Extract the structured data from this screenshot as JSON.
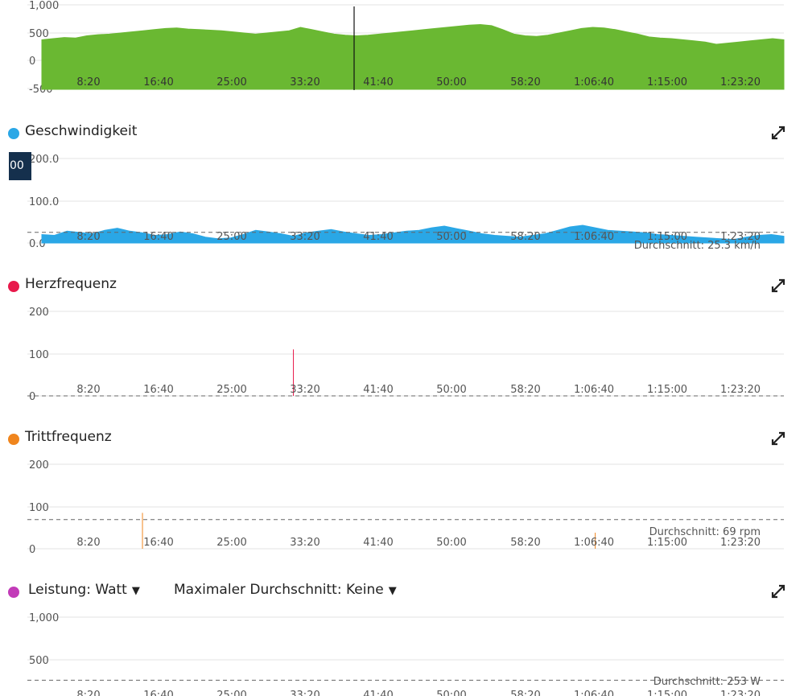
{
  "x_ticks": [
    "8:20",
    "16:40",
    "25:00",
    "33:20",
    "41:40",
    "50:00",
    "58:20",
    "1:06:40",
    "1:15:00",
    "1:23:20"
  ],
  "hover_label": "00",
  "charts": [
    {
      "id": "elevation",
      "title": "",
      "color": "#6ab832",
      "y_ticks": [
        "1,000",
        "500",
        "0",
        "-500"
      ],
      "avg_label": ""
    },
    {
      "id": "speed",
      "title": "Geschwindigkeit",
      "color": "#2aa7e6",
      "y_ticks": [
        "200.0",
        "100.0",
        "0.0"
      ],
      "avg_label": "Durchschnitt: 25.3 km/h"
    },
    {
      "id": "heartrate",
      "title": "Herzfrequenz",
      "color": "#e8194b",
      "y_ticks": [
        "200",
        "100",
        "0"
      ],
      "avg_label": ""
    },
    {
      "id": "cadence",
      "title": "Trittfrequenz",
      "color": "#f0851d",
      "y_ticks": [
        "200",
        "100",
        "0"
      ],
      "avg_label": "Durchschnitt: 69 rpm"
    },
    {
      "id": "power",
      "title": "",
      "color": "#c23bb8",
      "y_ticks": [
        "1,000",
        "500"
      ],
      "avg_label": "Durchschnitt: 253 W"
    }
  ],
  "power_header": {
    "metric_select": "Leistung: Watt",
    "max_avg_select": "Maximaler Durchschnitt: Keine"
  },
  "chart_data": [
    {
      "type": "area",
      "series": [
        {
          "values": [
            380,
            400,
            420,
            410,
            450,
            470,
            480,
            500,
            520,
            540,
            560,
            580,
            590,
            570,
            560,
            550,
            540,
            520,
            500,
            480,
            500,
            520,
            540,
            600,
            560,
            520,
            480,
            460,
            450,
            460,
            480,
            500,
            520,
            540,
            560,
            580,
            600,
            620,
            640,
            650,
            630,
            560,
            480,
            450,
            440,
            460,
            500,
            540,
            580,
            600,
            590,
            560,
            520,
            480,
            430,
            410,
            400,
            380,
            360,
            340,
            300,
            320,
            340,
            360,
            380,
            400,
            380
          ]
        }
      ],
      "x_range": [
        0,
        5520
      ],
      "ylim": [
        -500,
        1000
      ]
    },
    {
      "type": "area",
      "series": [
        {
          "values": [
            20,
            18,
            28,
            25,
            22,
            30,
            35,
            28,
            24,
            18,
            20,
            26,
            22,
            14,
            10,
            12,
            20,
            30,
            26,
            22,
            16,
            24,
            28,
            32,
            26,
            22,
            18,
            20,
            24,
            28,
            30,
            36,
            40,
            34,
            28,
            22,
            18,
            16,
            14,
            18,
            22,
            30,
            38,
            42,
            36,
            30,
            28,
            26,
            24,
            20,
            18,
            16,
            14,
            12,
            10,
            8,
            14,
            18,
            20,
            16
          ]
        }
      ],
      "x_range": [
        0,
        5520
      ],
      "ylim": [
        0,
        200
      ],
      "average": 25.3
    },
    {
      "type": "line",
      "series": [
        {
          "values": [
            0,
            0,
            0,
            0,
            0,
            0,
            0,
            0,
            0,
            0,
            0,
            0,
            0,
            0,
            0,
            0,
            0,
            0,
            0,
            0,
            110,
            0,
            0,
            0,
            0,
            0,
            0,
            0,
            0,
            0,
            0,
            0,
            0,
            0,
            0,
            0,
            0,
            0,
            0,
            0,
            0,
            0,
            0,
            0,
            0,
            0,
            0,
            0,
            0,
            0,
            0,
            0,
            0,
            0,
            0,
            0,
            0,
            0,
            0,
            0
          ]
        }
      ],
      "x_range": [
        0,
        5520
      ],
      "ylim": [
        0,
        200
      ]
    },
    {
      "type": "line",
      "series": [
        {
          "values": [
            0,
            0,
            0,
            0,
            0,
            0,
            0,
            0,
            85,
            0,
            0,
            0,
            0,
            0,
            0,
            0,
            0,
            0,
            0,
            0,
            0,
            0,
            0,
            0,
            0,
            0,
            0,
            0,
            0,
            0,
            0,
            0,
            0,
            0,
            0,
            0,
            0,
            0,
            0,
            0,
            0,
            0,
            0,
            0,
            38,
            0,
            0,
            0,
            0,
            0,
            0,
            0,
            0,
            0,
            0,
            0,
            0,
            0,
            0,
            0
          ]
        }
      ],
      "x_range": [
        0,
        5520
      ],
      "ylim": [
        0,
        200
      ],
      "average": 69
    },
    {
      "type": "line",
      "series": [
        {
          "values": []
        }
      ],
      "x_range": [
        0,
        5520
      ],
      "ylim": [
        0,
        1000
      ],
      "average": 253
    }
  ]
}
